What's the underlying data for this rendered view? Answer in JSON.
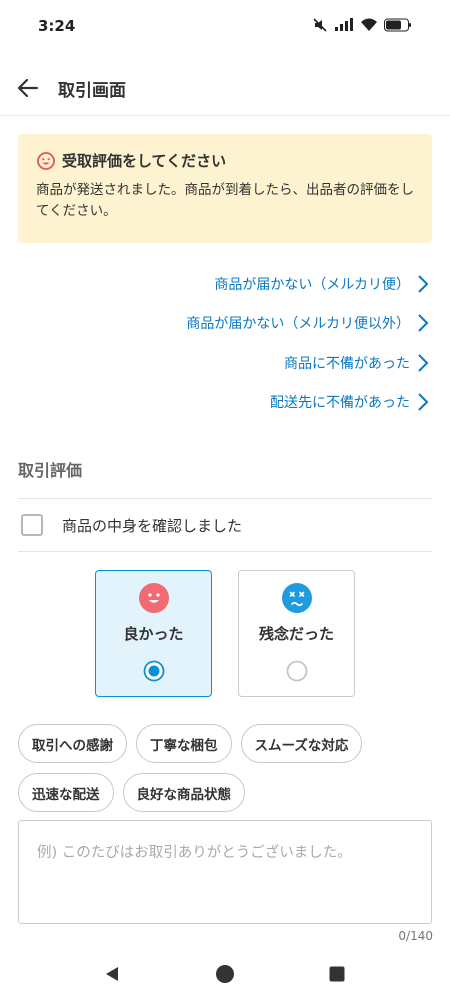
{
  "status_bar": {
    "time": "3:24"
  },
  "app_bar": {
    "title": "取引画面"
  },
  "notice": {
    "title": "受取評価をしてください",
    "body": "商品が発送されました。商品が到着したら、出品者の評価をしてください。",
    "accent_color": "#ef4d58"
  },
  "links": [
    {
      "label": "商品が届かない（メルカリ便）"
    },
    {
      "label": "商品が届かない（メルカリ便以外）"
    },
    {
      "label": "商品に不備があった"
    },
    {
      "label": "配送先に不備があった"
    }
  ],
  "rating": {
    "section_title": "取引評価",
    "confirm_label": "商品の中身を確認しました",
    "confirm_checked": false,
    "options": [
      {
        "label": "良かった",
        "selected": true,
        "icon": "smile-face-icon",
        "color": "#f26b72"
      },
      {
        "label": "残念だった",
        "selected": false,
        "icon": "sad-face-icon",
        "color": "#1f9be0"
      }
    ],
    "tags": [
      "取引への感謝",
      "丁寧な梱包",
      "スムーズな対応",
      "迅速な配送",
      "良好な商品状態"
    ],
    "comment_placeholder": "例) このたびはお取引ありがとうございました。",
    "comment_value": "",
    "counter": "0/140"
  },
  "colors": {
    "link": "#0b78c2",
    "selected": "#0b8fd4",
    "notice_bg": "#fdf3d1"
  }
}
